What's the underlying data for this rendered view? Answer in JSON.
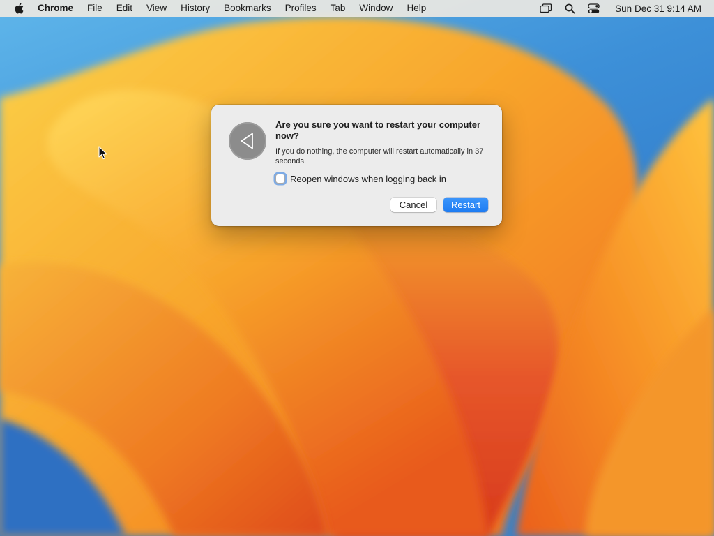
{
  "menubar": {
    "apple_icon": "apple-logo-icon",
    "app_name": "Chrome",
    "items": [
      {
        "label": "File"
      },
      {
        "label": "Edit"
      },
      {
        "label": "View"
      },
      {
        "label": "History"
      },
      {
        "label": "Bookmarks"
      },
      {
        "label": "Profiles"
      },
      {
        "label": "Tab"
      },
      {
        "label": "Window"
      },
      {
        "label": "Help"
      }
    ],
    "status_icons": [
      "screen-mirroring-icon",
      "spotlight-search-icon",
      "control-center-icon"
    ],
    "clock": "Sun Dec 31  9:14 AM"
  },
  "dialog": {
    "icon": "restart-triangle-icon",
    "title": "Are you sure you want to restart your computer now?",
    "message": "If you do nothing, the computer will restart automatically in 37 seconds.",
    "checkbox_label": "Reopen windows when logging back in",
    "checkbox_checked": false,
    "cancel_label": "Cancel",
    "restart_label": "Restart",
    "accent_color": "#1e7cf2"
  }
}
